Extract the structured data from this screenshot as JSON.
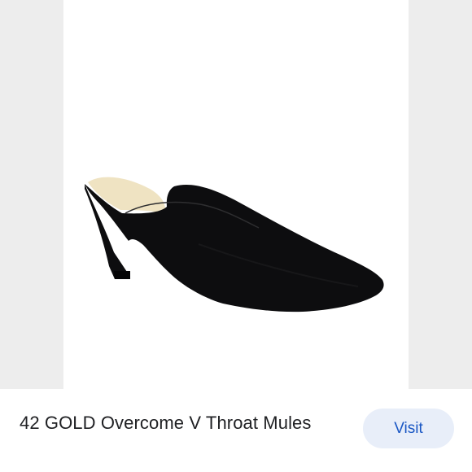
{
  "product": {
    "image_icon": "black-pointed-toe-mule-shoe",
    "title": "42 GOLD Overcome V Throat Mules"
  },
  "actions": {
    "visit_label": "Visit"
  },
  "colors": {
    "background": "#ffffff",
    "image_side_panel": "#ededed",
    "title_text": "#202124",
    "button_bg": "#e8eef9",
    "button_text": "#1a57c4",
    "shoe": "#0d0d0f",
    "shoe_lining": "#efe3c2"
  }
}
